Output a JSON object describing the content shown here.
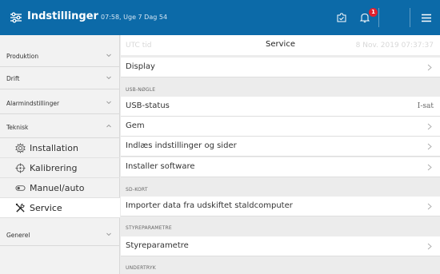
{
  "header": {
    "title": "Indstillinger",
    "time_info": "07:58, Uge 7 Dag 54",
    "notification_count": "1",
    "accent_color": "#0c6aa8",
    "icons": [
      "settings-sliders-icon",
      "clock-check-icon",
      "bell-icon",
      "hamburger-menu-icon"
    ]
  },
  "sidebar": {
    "groups": [
      {
        "label": "Produktion"
      },
      {
        "label": "Drift"
      },
      {
        "label": "Alarmindstillinger"
      },
      {
        "label": "Teknisk"
      },
      {
        "label": "Generel"
      }
    ],
    "teknisk_items": [
      {
        "label": "Installation",
        "icon": "gear-icon"
      },
      {
        "label": "Kalibrering",
        "icon": "crosshair-icon"
      },
      {
        "label": "Manuel/auto",
        "icon": "toggle-icon"
      },
      {
        "label": "Service",
        "icon": "tools-icon",
        "active": true
      }
    ]
  },
  "main": {
    "title": "Service",
    "ghost_left": "UTC tid",
    "ghost_right": "8 Nov. 2019 07:37:37",
    "display_label": "Display",
    "sections": {
      "usb": "USB-NØGLE",
      "sd": "SD-KORT",
      "styre": "STYREPARAMETRE",
      "under": "UNDERTRYK"
    },
    "usb_rows": [
      {
        "label": "USB-status",
        "value": "I-sat"
      },
      {
        "label": "Gem"
      },
      {
        "label": "Indlæs indstillinger og sider"
      },
      {
        "label": "Installer software"
      }
    ],
    "sd_rows": [
      {
        "label": "Importer data fra udskiftet staldcomputer"
      }
    ],
    "styre_rows": [
      {
        "label": "Styreparametre"
      }
    ]
  }
}
